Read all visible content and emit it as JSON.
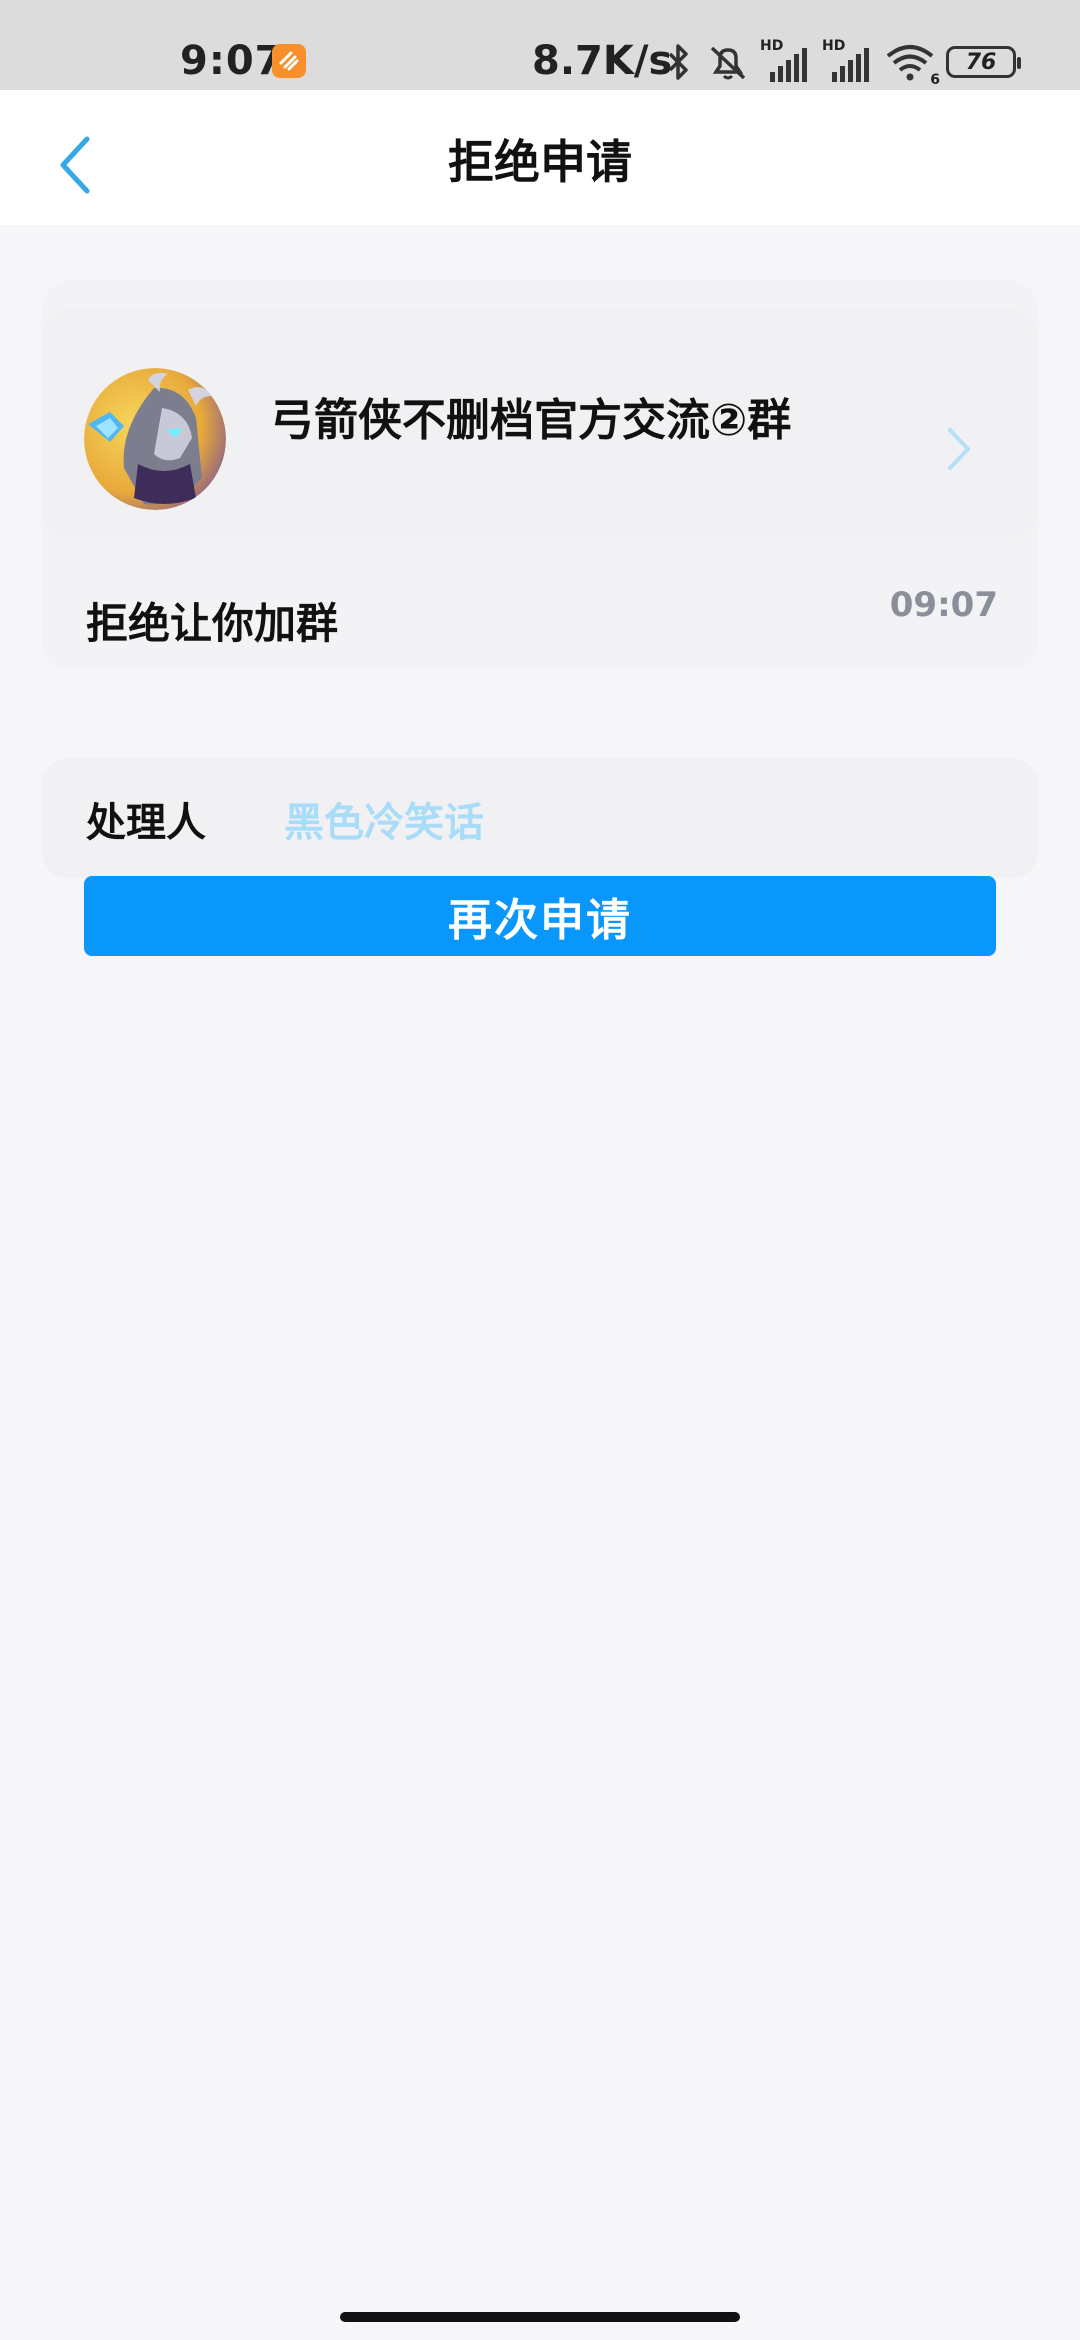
{
  "status_bar": {
    "time": "9:07",
    "network_speed": "8.7K/s",
    "signal_1_label": "HD",
    "signal_2_label": "HD",
    "wifi_label": "6",
    "battery": "76"
  },
  "nav": {
    "title": "拒绝申请"
  },
  "request": {
    "group_name": "弓箭侠不删档官方交流②群",
    "message": "拒绝让你加群",
    "time": "09:07"
  },
  "handler": {
    "label": "处理人",
    "name": "黑色冷笑话"
  },
  "actions": {
    "reapply_label": "再次申请"
  },
  "colors": {
    "accent": "#0997fb",
    "link_light": "#a8dcf8",
    "back_icon": "#35a8e6",
    "background": "#f6f6f9"
  },
  "icons": [
    "back-arrow-icon",
    "chevron-right-icon",
    "bluetooth-icon",
    "mute-bell-icon",
    "wifi-icon",
    "battery-icon"
  ]
}
